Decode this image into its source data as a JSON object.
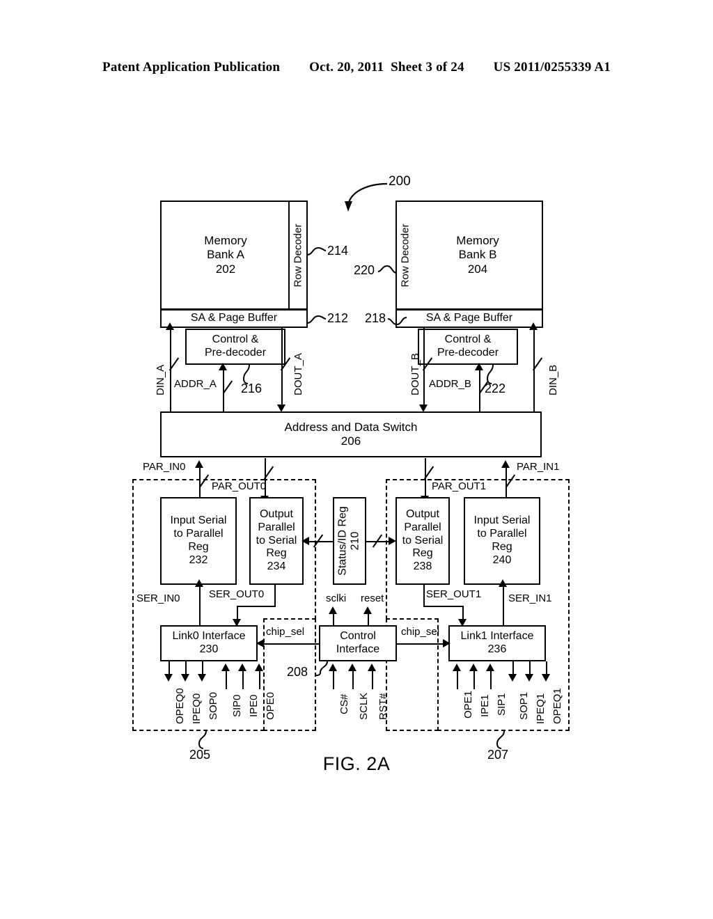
{
  "header": {
    "publication": "Patent Application Publication",
    "date": "Oct. 20, 2011",
    "sheet": "Sheet 3 of 24",
    "number": "US 2011/0255339 A1"
  },
  "figure": {
    "caption": "FIG. 2A",
    "system_ref": "200"
  },
  "banks": {
    "a": {
      "label_line1": "Memory",
      "label_line2": "Bank A",
      "ref": "202",
      "row_decoder": "Row Decoder",
      "row_decoder_ref": "214",
      "sa_page_buffer": "SA & Page Buffer",
      "sa_ref": "212",
      "control": "Control &",
      "control2": "Pre-decoder",
      "control_ref": "216",
      "din": "DIN_A",
      "addr": "ADDR_A",
      "dout": "DOUT_A"
    },
    "b": {
      "label_line1": "Memory",
      "label_line2": "Bank B",
      "ref": "204",
      "row_decoder": "Row Decoder",
      "row_decoder_ref": "220",
      "sa_page_buffer": "SA & Page Buffer",
      "sa_ref": "218",
      "control": "Control &",
      "control2": "Pre-decoder",
      "control_ref": "222",
      "din": "DIN_B",
      "addr": "ADDR_B",
      "dout": "DOUT_B"
    }
  },
  "switch": {
    "title": "Address and Data Switch",
    "ref": "206"
  },
  "buses": {
    "par_in0": "PAR_IN0",
    "par_out0": "PAR_OUT0",
    "par_in1": "PAR_IN1",
    "par_out1": "PAR_OUT1",
    "ser_in0": "SER_IN0",
    "ser_out0": "SER_OUT0",
    "ser_in1": "SER_IN1",
    "ser_out1": "SER_OUT1",
    "sclki": "sclki",
    "reset": "reset",
    "chip_sel_left": "chip_sel",
    "chip_sel_right": "chip_sel"
  },
  "registers": {
    "input_serial_0": {
      "l1": "Input Serial",
      "l2": "to Parallel",
      "l3": "Reg",
      "ref": "232"
    },
    "output_parallel_0": {
      "l1": "Output",
      "l2": "Parallel",
      "l3": "to Serial",
      "l4": "Reg",
      "ref": "234"
    },
    "status_id": {
      "l1": "Status/ID Reg",
      "ref": "210"
    },
    "output_parallel_1": {
      "l1": "Output",
      "l2": "Parallel",
      "l3": "to Serial",
      "l4": "Reg",
      "ref": "238"
    },
    "input_serial_1": {
      "l1": "Input Serial",
      "l2": "to Parallel",
      "l3": "Reg",
      "ref": "240"
    }
  },
  "interfaces": {
    "link0": {
      "title": "Link0 Interface",
      "ref": "230"
    },
    "control": {
      "l1": "Control",
      "l2": "Interface",
      "ref": "208"
    },
    "link1": {
      "title": "Link1 Interface",
      "ref": "236"
    }
  },
  "pins": {
    "link0_out": [
      "OPEQ0",
      "IPEQ0",
      "SOP0"
    ],
    "link0_in": [
      "SIP0",
      "IPE0",
      "OPE0"
    ],
    "control_in": [
      "CS#",
      "SCLK",
      "RST#"
    ],
    "link1_in": [
      "OPE1",
      "IPE1",
      "SIP1"
    ],
    "link1_out": [
      "SOP1",
      "IPEQ1",
      "OPEQ1"
    ]
  },
  "regions": {
    "left_ref": "205",
    "right_ref": "207"
  }
}
